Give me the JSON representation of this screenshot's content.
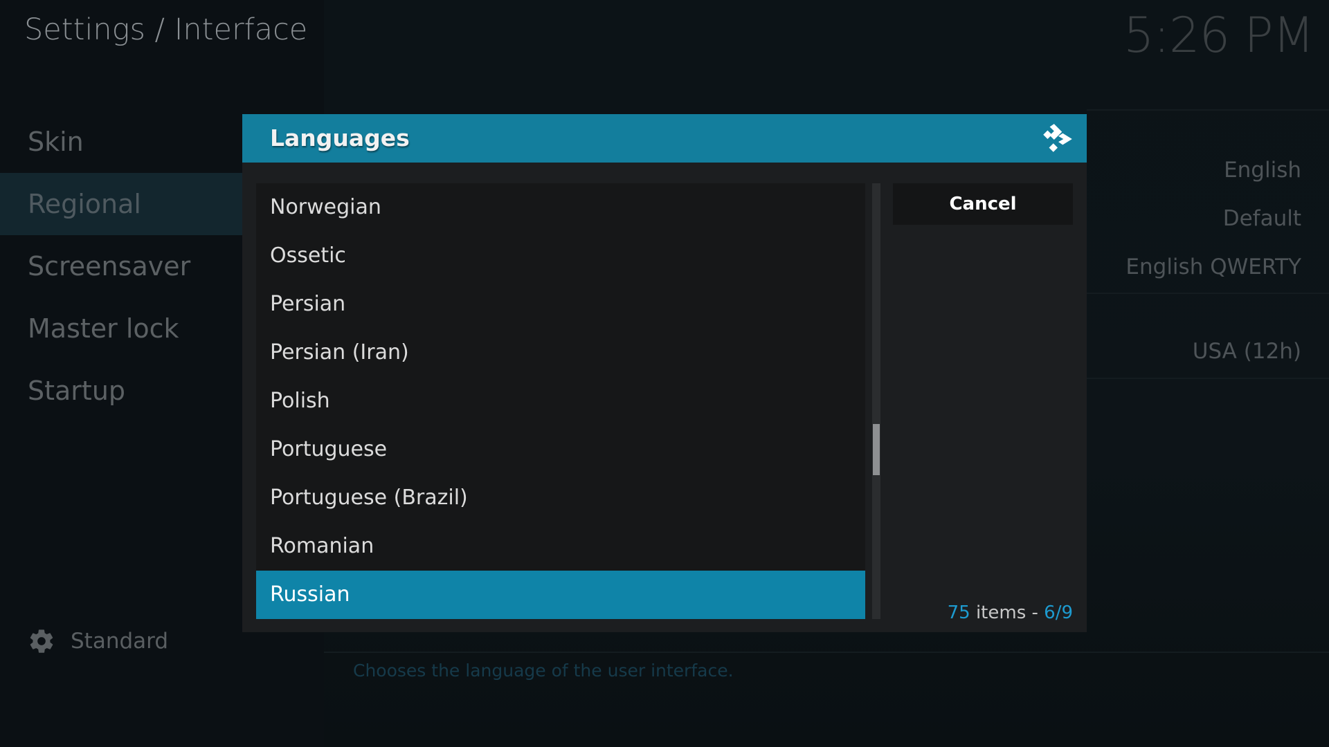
{
  "header": {
    "title": "Settings / Interface",
    "clock": "5:26 PM"
  },
  "sidebar": {
    "items": [
      {
        "label": "Skin"
      },
      {
        "label": "Regional"
      },
      {
        "label": "Screensaver"
      },
      {
        "label": "Master lock"
      },
      {
        "label": "Startup"
      }
    ],
    "selected_index": 1,
    "level_label": "Standard"
  },
  "background_settings": {
    "values": [
      "English",
      "Default",
      "English QWERTY",
      "USA (12h)"
    ],
    "description": "Chooses the language of the user interface."
  },
  "dialog": {
    "title": "Languages",
    "cancel_label": "Cancel",
    "items": [
      "Norwegian",
      "Ossetic",
      "Persian",
      "Persian (Iran)",
      "Polish",
      "Portuguese",
      "Portuguese (Brazil)",
      "Romanian",
      "Russian"
    ],
    "selected_index": 8,
    "count_total": "75",
    "count_word": " items - ",
    "page": "6/9",
    "scroll_position": 0.625
  },
  "colors": {
    "accent": "#137e9d",
    "selection": "#0f84a8",
    "count_accent": "#1d9bd0"
  }
}
